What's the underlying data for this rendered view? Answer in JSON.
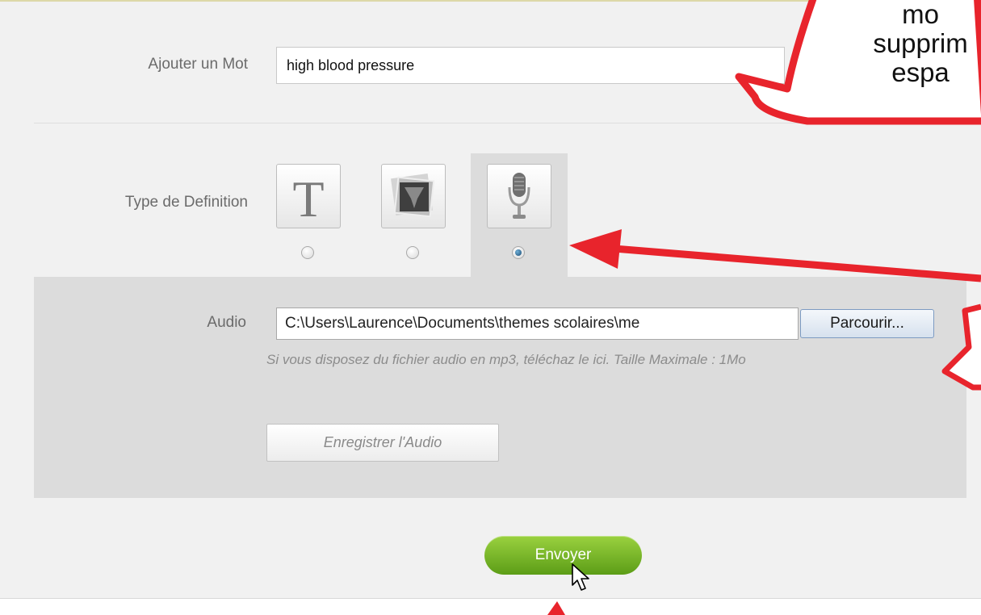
{
  "form": {
    "word_label": "Ajouter un Mot",
    "word_value": "high blood pressure",
    "type_label": "Type de Definition",
    "definition_types": [
      {
        "name": "text",
        "icon": "text-t-icon",
        "selected": false
      },
      {
        "name": "image",
        "icon": "picture-icon",
        "selected": false
      },
      {
        "name": "audio",
        "icon": "microphone-icon",
        "selected": true
      }
    ],
    "audio_label": "Audio",
    "file_value": "C:\\Users\\Laurence\\Documents\\themes scolaires\\me",
    "browse_label": "Parcourir...",
    "hint": "Si vous disposez du fichier audio en mp3, téléchaz le ici. Taille Maximale : 1Mo",
    "record_label": "Enregistrer l'Audio",
    "submit_label": "Envoyer"
  },
  "annotation": {
    "line1": "mo",
    "line2": "supprim",
    "line3": "espa"
  },
  "colors": {
    "annotation_red": "#e8242c",
    "submit_green": "#7cbb2a"
  }
}
